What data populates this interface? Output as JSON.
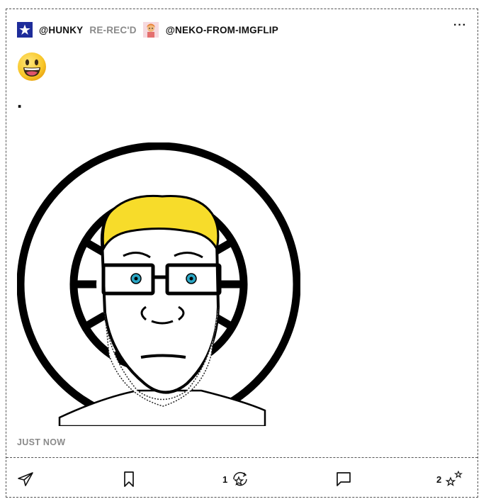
{
  "post": {
    "author_handle": "@HUNKY",
    "rerec_label": "RE-REC'D",
    "original_handle": "@NEKO-FROM-IMGFLIP",
    "more_label": "···",
    "emoji": "smiley-face",
    "body_text": ".",
    "timestamp": "JUST NOW"
  },
  "actions": {
    "rerec_count": "1",
    "star_count": "2"
  },
  "colors": {
    "avatar_blue": "#1e2c9a",
    "meme_yellow": "#f7dc2a",
    "eye_blue": "#2aa6c4",
    "muted_gray": "#8a8a8a"
  },
  "icons": [
    "star-icon",
    "send-icon",
    "bookmark-icon",
    "rerec-icon",
    "comment-icon",
    "sparkle-star-icon",
    "more-icon"
  ]
}
